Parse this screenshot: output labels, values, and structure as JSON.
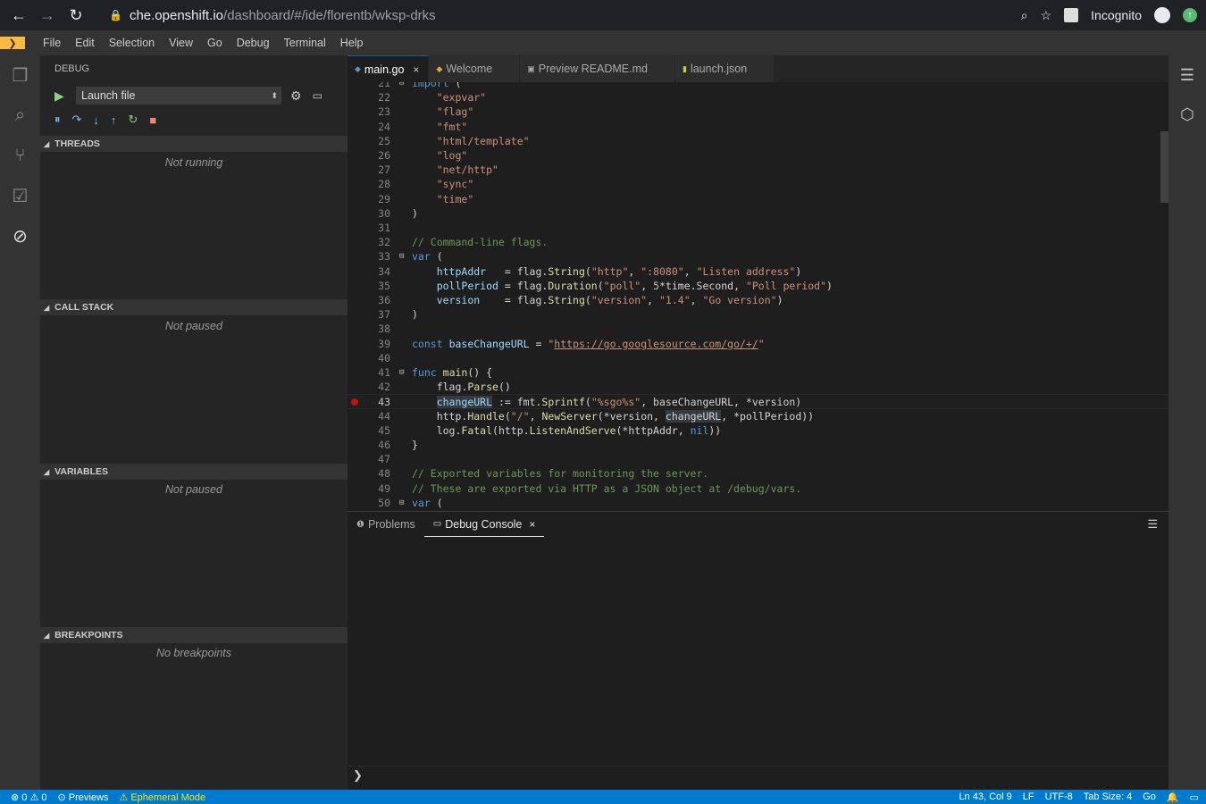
{
  "browser": {
    "url_host": "che.openshift.io",
    "url_path": "/dashboard/#/ide/florentb/wksp-drks",
    "profile": "Incognito"
  },
  "menu": [
    "File",
    "Edit",
    "Selection",
    "View",
    "Go",
    "Debug",
    "Terminal",
    "Help"
  ],
  "debug": {
    "title": "DEBUG",
    "launch_config": "Launch file",
    "sections": [
      {
        "title": "THREADS",
        "status": "Not running"
      },
      {
        "title": "CALL STACK",
        "status": "Not paused"
      },
      {
        "title": "VARIABLES",
        "status": "Not paused"
      },
      {
        "title": "BREAKPOINTS",
        "status": "No breakpoints"
      }
    ]
  },
  "tabs": [
    {
      "label": "main.go",
      "active": true
    },
    {
      "label": "Welcome"
    },
    {
      "label": "Preview README.md"
    },
    {
      "label": "launch.json"
    }
  ],
  "editor": {
    "lines": [
      {
        "n": "21",
        "html": "<span class=\"k\">import</span> ("
      },
      {
        "n": "22",
        "html": "    <span class=\"s\">\"expvar\"</span>"
      },
      {
        "n": "23",
        "html": "    <span class=\"s\">\"flag\"</span>"
      },
      {
        "n": "24",
        "html": "    <span class=\"s\">\"fmt\"</span>"
      },
      {
        "n": "25",
        "html": "    <span class=\"s\">\"html/template\"</span>"
      },
      {
        "n": "26",
        "html": "    <span class=\"s\">\"log\"</span>"
      },
      {
        "n": "27",
        "html": "    <span class=\"s\">\"net/http\"</span>"
      },
      {
        "n": "28",
        "html": "    <span class=\"s\">\"sync\"</span>"
      },
      {
        "n": "29",
        "html": "    <span class=\"s\">\"time\"</span>"
      },
      {
        "n": "30",
        "html": ")"
      },
      {
        "n": "31",
        "html": ""
      },
      {
        "n": "32",
        "html": "<span class=\"c\">// Command-line flags.</span>"
      },
      {
        "n": "33",
        "html": "<span class=\"k\">var</span> (",
        "fold": true
      },
      {
        "n": "34",
        "html": "    <span class=\"v\">httpAddr</span>   = flag.<span class=\"f\">String</span>(<span class=\"s\">\"http\"</span>, <span class=\"s\">\":8080\"</span>, <span class=\"s\">\"Listen address\"</span>)"
      },
      {
        "n": "35",
        "html": "    <span class=\"v\">pollPeriod</span> = flag.<span class=\"f\">Duration</span>(<span class=\"s\">\"poll\"</span>, <span class=\"n\">5</span>*time.Second, <span class=\"s\">\"Poll period\"</span>)"
      },
      {
        "n": "36",
        "html": "    <span class=\"v\">version</span>    = flag.<span class=\"f\">String</span>(<span class=\"s\">\"version\"</span>, <span class=\"s\">\"1.4\"</span>, <span class=\"s\">\"Go version\"</span>)"
      },
      {
        "n": "37",
        "html": ")"
      },
      {
        "n": "38",
        "html": ""
      },
      {
        "n": "39",
        "html": "<span class=\"k\">const</span> <span class=\"v\">baseChangeURL</span> = <span class=\"s\">\"<span class=\"u\">https://go.googlesource.com/go/+/</span>\"</span>"
      },
      {
        "n": "40",
        "html": ""
      },
      {
        "n": "41",
        "html": "<span class=\"k\">func</span> <span class=\"f\">main</span>() {",
        "fold": true
      },
      {
        "n": "42",
        "html": "    flag.<span class=\"f\">Parse</span>()"
      },
      {
        "n": "43",
        "html": "    <span class=\"v hl\">changeURL</span> := fmt.<span class=\"f\">Sprintf</span>(<span class=\"s\">\"%sgo%s\"</span>, baseChangeURL, *version)",
        "current": true
      },
      {
        "n": "44",
        "html": "    http.<span class=\"f\">Handle</span>(<span class=\"s\">\"/\"</span>, <span class=\"f\">NewServer</span>(*version, <span class=\"hl\">changeURL</span>, *pollPeriod))"
      },
      {
        "n": "45",
        "html": "    log.<span class=\"f\">Fatal</span>(http.<span class=\"f\">ListenAndServe</span>(*httpAddr, <span class=\"k\">nil</span>))"
      },
      {
        "n": "46",
        "html": "}"
      },
      {
        "n": "47",
        "html": ""
      },
      {
        "n": "48",
        "html": "<span class=\"c\">// Exported variables for monitoring the server.</span>"
      },
      {
        "n": "49",
        "html": "<span class=\"c\">// These are exported via HTTP as a JSON object at /debug/vars.</span>"
      },
      {
        "n": "50",
        "html": "<span class=\"k\">var</span> (",
        "fold": true
      }
    ]
  },
  "panel": {
    "tabs": [
      {
        "label": "Problems"
      },
      {
        "label": "Debug Console",
        "active": true
      }
    ],
    "prompt": "❯"
  },
  "status": {
    "errors": "0",
    "warnings": "0",
    "previews": "Previews",
    "mode": "Ephemeral Mode",
    "cursor": "Ln 43, Col 9",
    "eol": "LF",
    "encoding": "UTF-8",
    "tab_size": "Tab Size: 4",
    "language": "Go"
  }
}
